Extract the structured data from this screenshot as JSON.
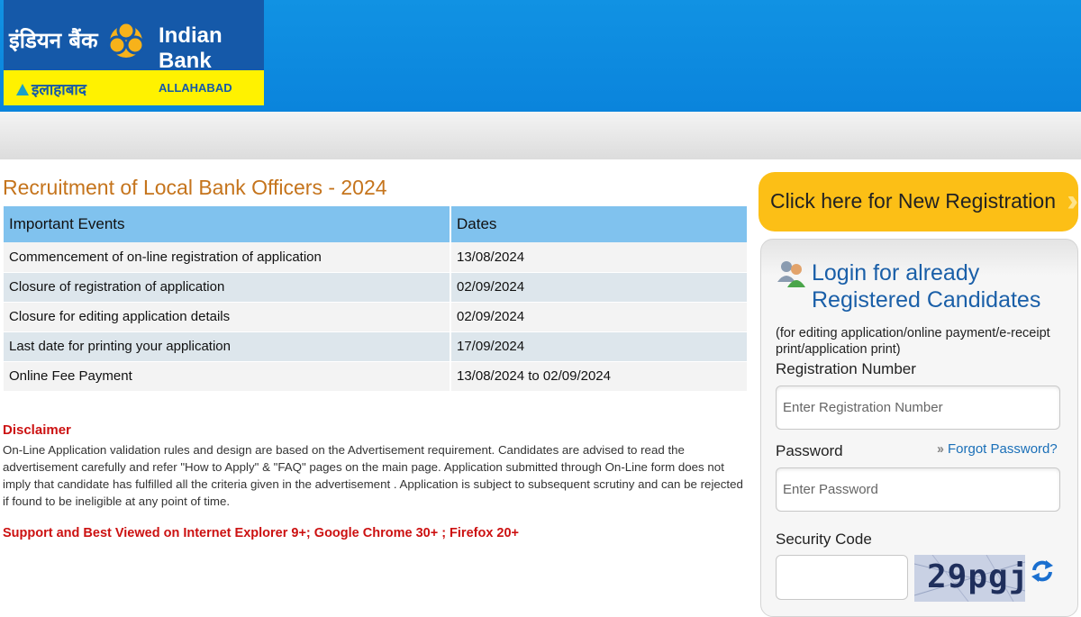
{
  "header": {
    "logo_hindi": "इंडियन बैंक",
    "logo_english": "Indian Bank",
    "logo_allahabad_hindi": "इलाहाबाद",
    "logo_allahabad_english": "ALLAHABAD"
  },
  "main": {
    "title": "Recruitment of Local Bank Officers - 2024",
    "table": {
      "headers": [
        "Important Events",
        "Dates"
      ],
      "rows": [
        [
          "Commencement of on-line registration of application",
          "13/08/2024"
        ],
        [
          "Closure of registration of application",
          "02/09/2024"
        ],
        [
          "Closure for editing application details",
          "02/09/2024"
        ],
        [
          "Last date for printing your application",
          "17/09/2024"
        ],
        [
          "Online Fee Payment",
          "13/08/2024 to 02/09/2024"
        ]
      ]
    },
    "disclaimer_title": "Disclaimer",
    "disclaimer_text": "On-Line Application validation rules and design are based on the Advertisement requirement. Candidates are advised to read the advertisement carefully and refer \"How to Apply\" & \"FAQ\" pages on the main page. Application submitted through On-Line form does not imply that candidate has fulfilled all the criteria given in the advertisement . Application is subject to subsequent scrutiny and can be rejected if found to be ineligible at any point of time.",
    "support_text": "Support and Best Viewed on Internet Explorer 9+; Google Chrome 30+ ; Firefox 20+"
  },
  "sidebar": {
    "new_registration_label": "Click here for New Registration",
    "login_title": "Login for already Registered Candidates",
    "login_subtitle": "(for editing application/online payment/e-receipt print/application print)",
    "registration_label": "Registration Number",
    "registration_placeholder": "Enter Registration Number",
    "password_label": "Password",
    "forgot_password": "Forgot Password?",
    "password_placeholder": "Enter Password",
    "security_code_label": "Security Code",
    "captcha_text": "29pgj"
  },
  "colors": {
    "header_blue": "#0a84dc",
    "title_orange": "#c5741c",
    "table_header": "#80c2ee",
    "disclaimer_red": "#cc1111",
    "register_button": "#fcbf16",
    "login_title_blue": "#1a5fa8"
  },
  "icons": [
    "indian-bank-emblem-icon",
    "allahabad-triangle-icon",
    "double-chevron-right-icon",
    "users-icon",
    "refresh-icon"
  ]
}
